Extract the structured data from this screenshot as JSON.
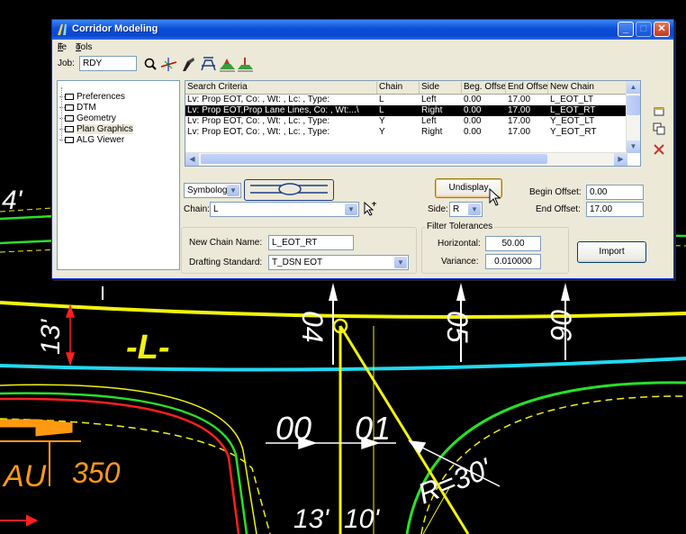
{
  "window": {
    "title": "Corridor Modeling"
  },
  "menu": [
    {
      "key": "F",
      "rest": "ile"
    },
    {
      "key": "T",
      "rest": "ools"
    }
  ],
  "job": {
    "label": "Job:",
    "value": "RDY"
  },
  "toolbar_icons": [
    "search-icon",
    "alignment-icon",
    "survey-icon",
    "cross-section-icon",
    "template-icon",
    "corridor-icon"
  ],
  "tree": [
    "Preferences",
    "DTM",
    "Geometry",
    "Plan Graphics",
    "ALG Viewer"
  ],
  "tree_selected": "Plan Graphics",
  "list": {
    "columns": [
      "Search Criteria",
      "Chain",
      "Side",
      "Beg. Offse",
      "End Offse",
      "New Chain"
    ],
    "rows": [
      [
        "Lv: Prop EOT, Co: , Wt: , Lc: , Type:",
        "L",
        "Left",
        "0.00",
        "17.00",
        "L_EOT_LT"
      ],
      [
        "Lv: Prop EOT,Prop Lane Lines, Co: , Wt:...\\",
        "L",
        "Right",
        "0.00",
        "17.00",
        "L_EOT_RT"
      ],
      [
        "Lv: Prop EOT, Co: , Wt: , Lc: , Type:",
        "Y",
        "Left",
        "0.00",
        "17.00",
        "Y_EOT_LT"
      ],
      [
        "Lv: Prop EOT, Co: , Wt: , Lc: , Type:",
        "Y",
        "Right",
        "0.00",
        "17.00",
        "Y_EOT_RT"
      ]
    ],
    "selected_row": 1
  },
  "symbology": {
    "value": "Symbology"
  },
  "chain": {
    "label": "Chain:",
    "value": "L"
  },
  "undisplay_label": "Undisplay",
  "side": {
    "label": "Side:",
    "value": "R"
  },
  "begin_offset": {
    "label": "Begin Offset:",
    "value": "0.00"
  },
  "end_offset": {
    "label": "End Offset:",
    "value": "17.00"
  },
  "new_chain_name": {
    "label": "New Chain Name:",
    "value": "L_EOT_RT"
  },
  "drafting_standard": {
    "label": "Drafting Standard:",
    "value": "T_DSN EOT"
  },
  "filter": {
    "title": "Filter Tolerances",
    "horizontal_label": "Horizontal:",
    "horizontal_value": "50.00",
    "variance_label": "Variance:",
    "variance_value": "0.010000"
  },
  "import_label": "Import",
  "side_icons": [
    "new-icon",
    "copy-icon",
    "delete-icon"
  ],
  "cad": {
    "texts": [
      "4'",
      "13'",
      "-L-",
      "04",
      "05",
      "06",
      "00",
      "01",
      "AU",
      "350",
      "R=30'",
      "13'",
      "10'"
    ]
  },
  "colors": {
    "yellow": "#f2f20a",
    "cyan": "#22d8f0",
    "green": "#28e028",
    "red": "#ff2020",
    "orange": "#ff9a10",
    "titlebar": "#0a4fd6",
    "selection": "#000000"
  }
}
